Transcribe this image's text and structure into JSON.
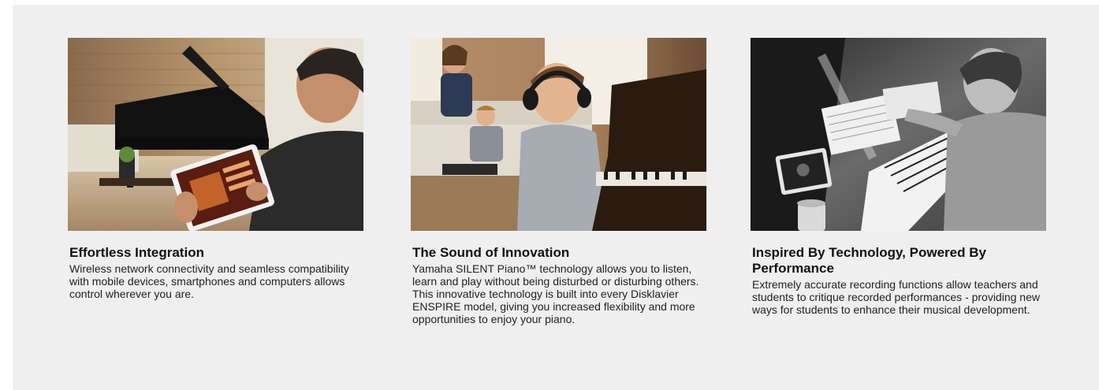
{
  "cards": [
    {
      "title": "Effortless Integration",
      "body": "Wireless network connectivity and seamless compatibility with mobile devices, smartphones and computers allows control wherever you are.",
      "photo_icon": "tablet-piano-photo"
    },
    {
      "title": "The Sound of Innovation",
      "body": "Yamaha SILENT Piano™ technology allows you to listen, learn and play without being disturbed or disturbing others. This innovative technology is built into every Disklavier ENSPIRE model, giving you increased flexibility and more opportunities to enjoy your piano.",
      "photo_icon": "headphones-piano-photo"
    },
    {
      "title": "Inspired By Technology, Powered By Performance",
      "body": "Extremely accurate recording functions allow teachers and students to critique recorded performances - providing new ways for students to enhance their musical development.",
      "photo_icon": "recording-piano-photo"
    }
  ],
  "colors": {
    "panel_bg": "#efefef",
    "title": "#111111",
    "body": "#222222"
  }
}
